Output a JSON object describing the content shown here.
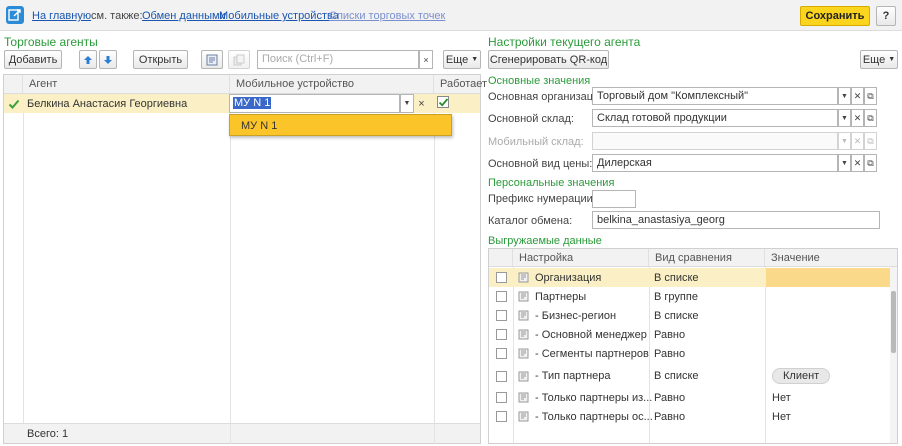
{
  "topbar": {
    "home_link": "На главную",
    "see_also": "см. также:",
    "links": [
      "Обмен данными",
      "Мобильные устройства",
      "Списки торговых точек"
    ],
    "save_button": "Сохранить",
    "help_button": "?"
  },
  "agents": {
    "title": "Торговые агенты",
    "toolbar": {
      "add": "Добавить",
      "open": "Открыть",
      "search_placeholder": "Поиск (Ctrl+F)",
      "clear": "×",
      "more": "Еще"
    },
    "columns": [
      "Агент",
      "Мобильное устройство",
      "Работает"
    ],
    "rows": [
      {
        "agent": "Белкина Анастасия Георгиевна",
        "device": "МУ N 1",
        "works": true
      }
    ],
    "dropdown_option": "МУ N 1",
    "footer": "Всего: 1"
  },
  "settings": {
    "title": "Настройки текущего агента",
    "qr_button": "Сгенерировать QR-код",
    "more": "Еще",
    "basic_group": "Основные значения",
    "fields": [
      {
        "label": "Основная организация:",
        "value": "Торговый дом \"Комплексный\""
      },
      {
        "label": "Основной склад:",
        "value": "Склад готовой продукции"
      },
      {
        "label": "Мобильный склад:",
        "value": ""
      },
      {
        "label": "Основной вид цены:",
        "value": "Дилерская"
      }
    ],
    "personal_group": "Персональные значения",
    "prefix_label": "Префикс нумерации:",
    "prefix_value": "",
    "catalog_label": "Каталог обмена:",
    "catalog_value": "belkina_anastasiya_georg",
    "export_group": "Выгружаемые данные",
    "export_columns": [
      "Настройка",
      "Вид сравнения",
      "Значение"
    ],
    "export_rows": [
      {
        "name": "Организация",
        "compare": "В списке",
        "value": ""
      },
      {
        "name": "Партнеры",
        "compare": "В группе",
        "value": ""
      },
      {
        "name": "- Бизнес-регион",
        "compare": "В списке",
        "value": ""
      },
      {
        "name": "- Основной менеджер",
        "compare": "Равно",
        "value": ""
      },
      {
        "name": "- Сегменты партнеров",
        "compare": "Равно",
        "value": ""
      },
      {
        "name": "- Тип партнера",
        "compare": "В списке",
        "value": "Клиент"
      },
      {
        "name": "- Только партнеры из...",
        "compare": "Равно",
        "value": "Нет"
      },
      {
        "name": "- Только партнеры ос...",
        "compare": "Равно",
        "value": "Нет"
      }
    ]
  },
  "colors": {
    "accent_green": "#2b9a3a",
    "link_blue": "#1a55b0",
    "save_yellow": "#fbd41e",
    "selected_row": "#fbf0c5",
    "dropdown_item": "#fbc52a"
  }
}
